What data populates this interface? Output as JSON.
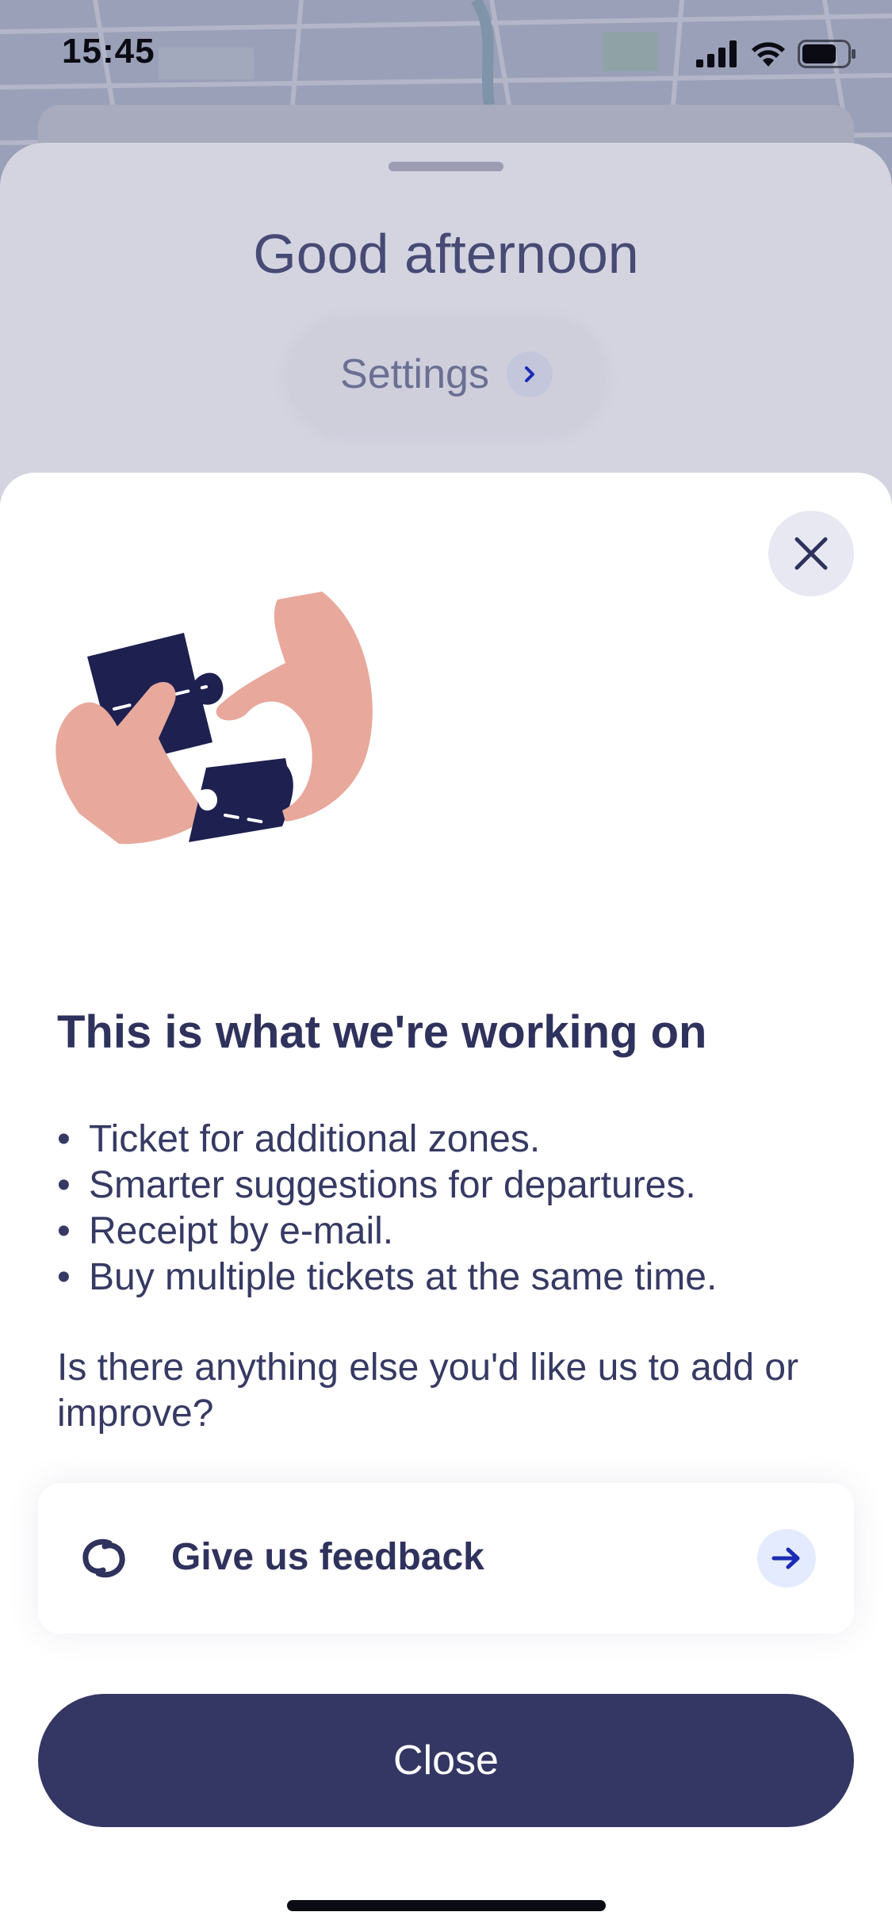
{
  "status_bar": {
    "time": "15:45",
    "icons": [
      "cellular-signal-icon",
      "wifi-icon",
      "battery-icon"
    ]
  },
  "home": {
    "greeting": "Good afternoon",
    "settings_label": "Settings"
  },
  "modal": {
    "title": "This is what we're working on",
    "bullets": [
      "Ticket for additional zones.",
      "Smarter suggestions for departures.",
      "Receipt by e-mail.",
      "Buy multiple tickets at the same time."
    ],
    "question": "Is there anything else you'd like us to add or improve?",
    "feedback_label": "Give us feedback",
    "close_label": "Close"
  },
  "colors": {
    "primary": "#343763",
    "text": "#2f325c",
    "illustration_skin": "#e8a89c",
    "illustration_piece": "#1e2050",
    "accent_blue": "#1a2bb5"
  }
}
